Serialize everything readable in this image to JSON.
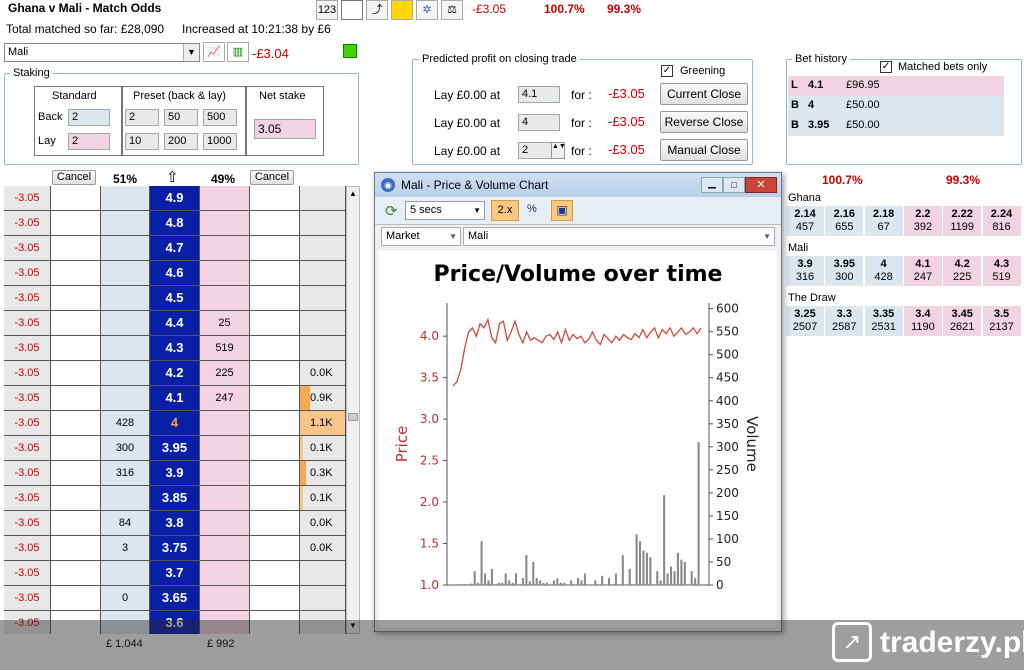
{
  "header": {
    "title": "Ghana v Mali - Match Odds",
    "total_matched": "Total matched so far: £28,090",
    "increased": "Increased at 10:21:38 by £6",
    "pl": "-£3.05",
    "book_back": "100.7%",
    "book_lay": "99.3%"
  },
  "selection": {
    "value": "Mali",
    "pl": "-£3.04"
  },
  "staking": {
    "legend": "Staking",
    "standard": "Standard",
    "preset": "Preset (back & lay)",
    "net": "Net stake",
    "back_label": "Back",
    "lay_label": "Lay",
    "back_val": "2",
    "lay_val": "2",
    "presets_back": [
      "2",
      "50",
      "500"
    ],
    "presets_lay": [
      "10",
      "200",
      "1000"
    ],
    "net_val": "3.05"
  },
  "predicted": {
    "legend": "Predicted profit on closing trade",
    "greening": "Greening",
    "rows": [
      {
        "lay": "Lay £0.00 at",
        "price": "4.1",
        "for": "for :",
        "profit": "-£3.05",
        "button": "Current Close"
      },
      {
        "lay": "Lay £0.00 at",
        "price": "4",
        "for": "for :",
        "profit": "-£3.05",
        "button": "Reverse Close"
      },
      {
        "lay": "Lay £0.00 at",
        "price": "2",
        "for": "for :",
        "profit": "-£3.05",
        "button": "Manual Close"
      }
    ]
  },
  "bet_history": {
    "legend": "Bet history",
    "matched_only": "Matched bets only",
    "rows": [
      {
        "type": "L",
        "price": "4.1",
        "amount": "£96.95"
      },
      {
        "type": "B",
        "price": "4",
        "amount": "£50.00"
      },
      {
        "type": "B",
        "price": "3.95",
        "amount": "£50.00"
      }
    ]
  },
  "ladder_header": {
    "cancel": "Cancel",
    "back_pct": "51%",
    "lay_pct": "49%"
  },
  "ladder": [
    {
      "pl": "-3.05",
      "back": "",
      "price": "4.9",
      "lay": "",
      "vol": ""
    },
    {
      "pl": "-3.05",
      "back": "",
      "price": "4.8",
      "lay": "",
      "vol": ""
    },
    {
      "pl": "-3.05",
      "back": "",
      "price": "4.7",
      "lay": "",
      "vol": ""
    },
    {
      "pl": "-3.05",
      "back": "",
      "price": "4.6",
      "lay": "",
      "vol": ""
    },
    {
      "pl": "-3.05",
      "back": "",
      "price": "4.5",
      "lay": "",
      "vol": ""
    },
    {
      "pl": "-3.05",
      "back": "",
      "price": "4.4",
      "lay": "25",
      "vol": ""
    },
    {
      "pl": "-3.05",
      "back": "",
      "price": "4.3",
      "lay": "519",
      "vol": ""
    },
    {
      "pl": "-3.05",
      "back": "",
      "price": "4.2",
      "lay": "225",
      "vol": "0.0K"
    },
    {
      "pl": "-3.05",
      "back": "",
      "price": "4.1",
      "lay": "247",
      "vol": "0.9K"
    },
    {
      "pl": "-3.05",
      "back": "428",
      "price": "4",
      "lay": "",
      "vol": "1.1K"
    },
    {
      "pl": "-3.05",
      "back": "300",
      "price": "3.95",
      "lay": "",
      "vol": "0.1K"
    },
    {
      "pl": "-3.05",
      "back": "316",
      "price": "3.9",
      "lay": "",
      "vol": "0.3K"
    },
    {
      "pl": "-3.05",
      "back": "",
      "price": "3.85",
      "lay": "",
      "vol": "0.1K"
    },
    {
      "pl": "-3.05",
      "back": "84",
      "price": "3.8",
      "lay": "",
      "vol": "0.0K"
    },
    {
      "pl": "-3.05",
      "back": "3",
      "price": "3.75",
      "lay": "",
      "vol": "0.0K"
    },
    {
      "pl": "-3.05",
      "back": "",
      "price": "3.7",
      "lay": "",
      "vol": ""
    },
    {
      "pl": "-3.05",
      "back": "0",
      "price": "3.65",
      "lay": "",
      "vol": ""
    },
    {
      "pl": "-3.05",
      "back": "",
      "price": "3.6",
      "lay": "",
      "vol": ""
    }
  ],
  "ladder_footer": {
    "back_total": "£ 1,044",
    "lay_total": "£ 992"
  },
  "markets": {
    "back_book": "100.7%",
    "lay_book": "99.3%",
    "runners": [
      {
        "name": "Ghana",
        "prices": [
          "2.14",
          "2.16",
          "2.18",
          "2.2",
          "2.22",
          "2.24"
        ],
        "vols": [
          "457",
          "655",
          "67",
          "392",
          "1199",
          "816"
        ]
      },
      {
        "name": "Mali",
        "prices": [
          "3.9",
          "3.95",
          "4",
          "4.1",
          "4.2",
          "4.3"
        ],
        "vols": [
          "316",
          "300",
          "428",
          "247",
          "225",
          "519"
        ]
      },
      {
        "name": "The Draw",
        "prices": [
          "3.25",
          "3.3",
          "3.35",
          "3.4",
          "3.45",
          "3.5"
        ],
        "vols": [
          "2507",
          "2587",
          "2531",
          "1190",
          "2621",
          "2137"
        ]
      }
    ]
  },
  "chart_window": {
    "title": "Mali - Price & Volume Chart",
    "interval": "5 secs",
    "zoom": "2.x",
    "pct": "%",
    "market": "Market",
    "runner": "Mali"
  },
  "chart_data": {
    "type": "line",
    "title": "Price/Volume over time",
    "ylabel_left": "Price",
    "ylabel_right": "Volume",
    "y_ticks_left": [
      "1.0",
      "1.5",
      "2.0",
      "2.5",
      "3.0",
      "3.5",
      "4.0"
    ],
    "y_ticks_right": [
      "0",
      "50",
      "100",
      "150",
      "200",
      "250",
      "300",
      "350",
      "400",
      "450",
      "500",
      "550",
      "600"
    ],
    "ylim_left": [
      1.0,
      4.4
    ],
    "ylim_right": [
      0,
      600
    ],
    "price": [
      3.4,
      3.45,
      3.6,
      3.85,
      4.05,
      4.1,
      4.0,
      4.15,
      4.1,
      4.2,
      3.98,
      3.92,
      4.15,
      4.18,
      3.95,
      4.05,
      4.18,
      4.02,
      3.92,
      4.05,
      3.95,
      3.98,
      3.95,
      3.92,
      4.0,
      4.02,
      3.96,
      4.05,
      3.92,
      4.08,
      3.95,
      4.02,
      3.97,
      4.0,
      3.92,
      3.96,
      4.05,
      3.95,
      3.9,
      4.02,
      3.97,
      3.92,
      4.0,
      3.95,
      4.02,
      3.98,
      3.96,
      4.03,
      3.98,
      4.08,
      3.98,
      4.05,
      4.1,
      3.98,
      4.08,
      4.03,
      4.1,
      4.0,
      4.05,
      4.1,
      4.02,
      4.05,
      4.1,
      4.03,
      4.1
    ],
    "volume": [
      0,
      2,
      0,
      2,
      0,
      3,
      30,
      5,
      95,
      25,
      10,
      35,
      0,
      5,
      5,
      25,
      10,
      5,
      25,
      0,
      15,
      65,
      8,
      50,
      15,
      10,
      5,
      5,
      0,
      10,
      15,
      5,
      5,
      0,
      10,
      0,
      15,
      10,
      25,
      0,
      0,
      10,
      0,
      20,
      0,
      15,
      0,
      25,
      0,
      65,
      0,
      35,
      0,
      110,
      95,
      75,
      70,
      60,
      0,
      30,
      10,
      195,
      25,
      40,
      30,
      70,
      55,
      50,
      0,
      30,
      15,
      310
    ]
  }
}
